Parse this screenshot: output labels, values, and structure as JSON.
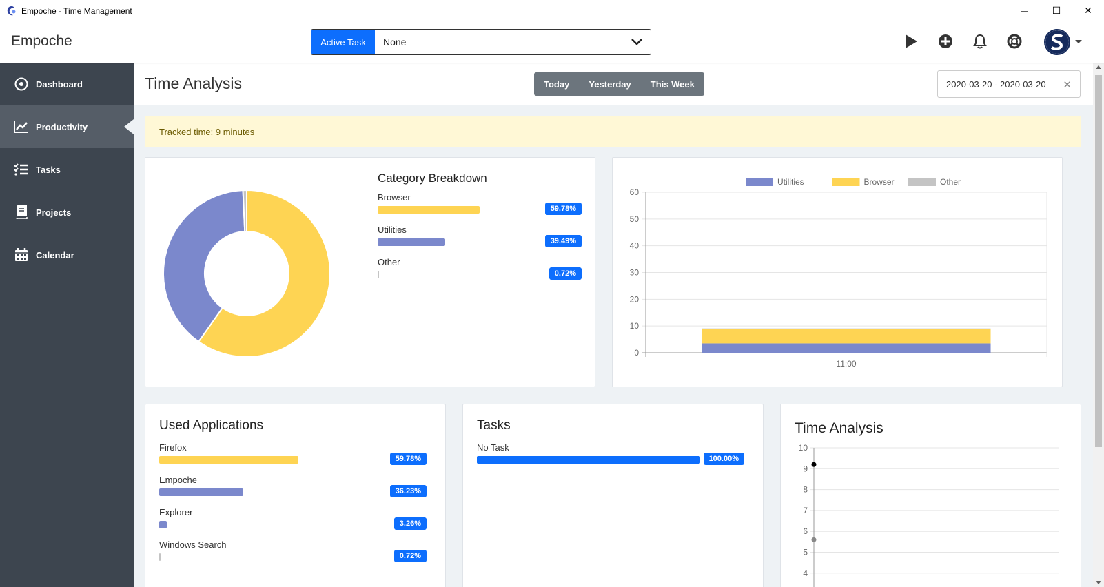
{
  "window": {
    "title": "Empoche - Time Management",
    "controls": [
      "─",
      "☐",
      "✕"
    ]
  },
  "topbar": {
    "brand": "Empoche",
    "active_task": {
      "label": "Active Task",
      "value": "None"
    }
  },
  "sidebar": {
    "items": [
      {
        "label": "Dashboard",
        "icon": "dashboard-icon",
        "active": false
      },
      {
        "label": "Productivity",
        "icon": "chart-icon",
        "active": true
      },
      {
        "label": "Tasks",
        "icon": "tasks-icon",
        "active": false
      },
      {
        "label": "Projects",
        "icon": "book-icon",
        "active": false
      },
      {
        "label": "Calendar",
        "icon": "calendar-icon",
        "active": false
      }
    ]
  },
  "page": {
    "title": "Time Analysis",
    "range_buttons": [
      "Today",
      "Yesterday",
      "This Week"
    ],
    "date_range": "2020-03-20 - 2020-03-20",
    "tracked_time": "Tracked time: 9 minutes"
  },
  "colors": {
    "browser": "#fed453",
    "utilities": "#7b88cc",
    "other": "#c4c4c4",
    "tasks": "#0d6efd",
    "badge": "#0d6efd"
  },
  "category_breakdown": {
    "title": "Category Breakdown",
    "items": [
      {
        "name": "Browser",
        "percent": "59.78%",
        "value": 59.78,
        "color": "#fed453"
      },
      {
        "name": "Utilities",
        "percent": "39.49%",
        "value": 39.49,
        "color": "#7b88cc"
      },
      {
        "name": "Other",
        "percent": "0.72%",
        "value": 0.72,
        "color": "#c4c4c4"
      }
    ]
  },
  "used_applications": {
    "title": "Used Applications",
    "items": [
      {
        "name": "Firefox",
        "percent": "59.78%",
        "value": 59.78,
        "color": "#fed453"
      },
      {
        "name": "Empoche",
        "percent": "36.23%",
        "value": 36.23,
        "color": "#7b88cc"
      },
      {
        "name": "Explorer",
        "percent": "3.26%",
        "value": 3.26,
        "color": "#7b88cc"
      },
      {
        "name": "Windows Search",
        "percent": "0.72%",
        "value": 0.72,
        "color": "#c4c4c4"
      }
    ]
  },
  "tasks_card": {
    "title": "Tasks",
    "items": [
      {
        "name": "No Task",
        "percent": "100.00%",
        "value": 100,
        "color": "#0d6efd"
      }
    ]
  },
  "time_analysis_card": {
    "title": "Time Analysis"
  },
  "chart_data": [
    {
      "type": "pie",
      "donut": true,
      "labels": [
        "Browser",
        "Utilities",
        "Other"
      ],
      "values": [
        59.78,
        39.49,
        0.72
      ],
      "colors": [
        "#fed453",
        "#7b88cc",
        "#c4c4c4"
      ]
    },
    {
      "type": "bar",
      "stacked": true,
      "categories": [
        "11:00"
      ],
      "series": [
        {
          "name": "Utilities",
          "values": [
            3.5
          ],
          "color": "#7b88cc"
        },
        {
          "name": "Browser",
          "values": [
            5.5
          ],
          "color": "#fed453"
        },
        {
          "name": "Other",
          "values": [
            0.1
          ],
          "color": "#c4c4c4"
        }
      ],
      "ylim": [
        0,
        60
      ],
      "yticks": [
        0,
        10,
        20,
        30,
        40,
        50,
        60
      ],
      "legend": "top",
      "grid": true
    },
    {
      "type": "scatter",
      "title": "Time Analysis",
      "points": [
        {
          "y": 9.2,
          "color": "#000000"
        },
        {
          "y": 5.6,
          "color": "#888888"
        }
      ],
      "ylim": [
        4,
        10
      ],
      "yticks": [
        4,
        5,
        6,
        7,
        8,
        9,
        10
      ],
      "grid": true
    }
  ]
}
